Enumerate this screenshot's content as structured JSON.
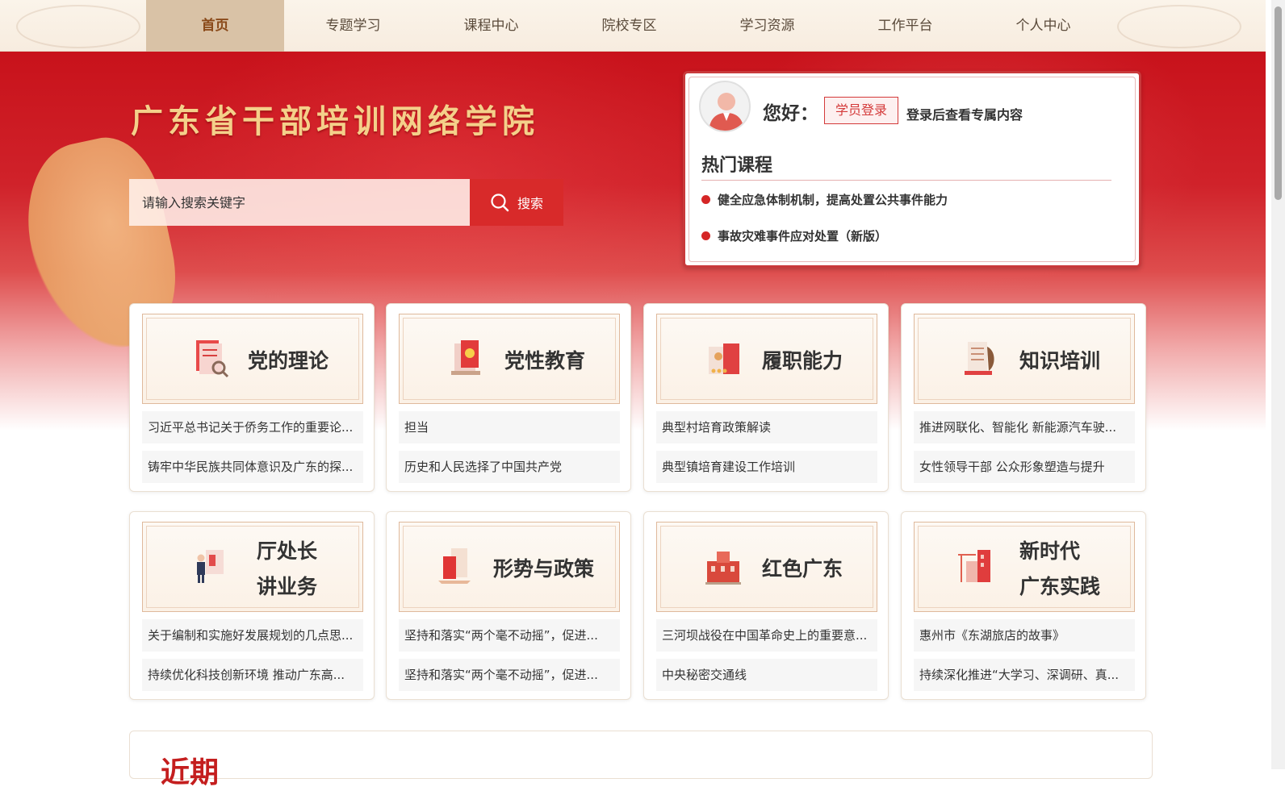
{
  "nav": {
    "items": [
      {
        "label": "首页",
        "active": true
      },
      {
        "label": "专题学习"
      },
      {
        "label": "课程中心"
      },
      {
        "label": "院校专区"
      },
      {
        "label": "学习资源"
      },
      {
        "label": "工作平台"
      },
      {
        "label": "个人中心"
      }
    ]
  },
  "hero": {
    "title": "广东省干部培训网络学院",
    "search_placeholder": "请输入搜索关键字",
    "search_button": "搜索"
  },
  "login": {
    "greeting": "您好：",
    "login_button": "学员登录",
    "tip": "登录后查看专属内容",
    "hot_title": "热门课程",
    "hot_courses": [
      "健全应急体制机制，提高处置公共事件能力",
      "事故灾难事件应对处置（新版）"
    ]
  },
  "categories": [
    {
      "title": "党的理论",
      "icon": "party-theory-icon",
      "links": [
        "习近平总书记关于侨务工作的重要论...",
        "铸牢中华民族共同体意识及广东的探..."
      ]
    },
    {
      "title": "党性教育",
      "icon": "party-spirit-icon",
      "links": [
        "担当",
        "历史和人民选择了中国共产党"
      ]
    },
    {
      "title": "履职能力",
      "icon": "duty-ability-icon",
      "links": [
        "典型村培育政策解读",
        "典型镇培育建设工作培训"
      ]
    },
    {
      "title": "知识培训",
      "icon": "knowledge-icon",
      "links": [
        "推进网联化、智能化 新能源汽车驶...",
        "女性领导干部 公众形象塑造与提升"
      ]
    },
    {
      "title_lines": [
        "厅处长",
        "讲业务"
      ],
      "icon": "director-icon",
      "links": [
        "关于编制和实施好发展规划的几点思...",
        "持续优化科技创新环境 推动广东高..."
      ]
    },
    {
      "title": "形势与政策",
      "icon": "policy-icon",
      "links": [
        "坚持和落实“两个毫不动摇”，促进...",
        "坚持和落实“两个毫不动摇”，促进..."
      ]
    },
    {
      "title": "红色广东",
      "icon": "red-guangdong-icon",
      "links": [
        "三河坝战役在中国革命史上的重要意...",
        "中央秘密交通线"
      ]
    },
    {
      "title_lines": [
        "新时代",
        "广东实践"
      ],
      "icon": "new-era-icon",
      "links": [
        "惠州市《东湖旅店的故事》",
        "持续深化推进“大学习、深调研、真..."
      ]
    }
  ],
  "colors": {
    "primary_red": "#d82a2a",
    "gold": "#f4d08a",
    "nav_active": "#d9c2a6"
  },
  "section": {
    "title": "近期"
  }
}
